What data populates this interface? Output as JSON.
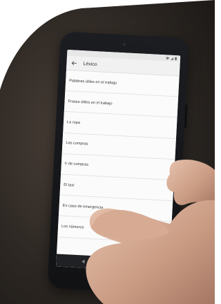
{
  "screen": {
    "title": "Léxico",
    "items": [
      {
        "label": "Palabras útiles en el trabajo"
      },
      {
        "label": "Frases útiles en el trabajo"
      },
      {
        "label": "La ropa"
      },
      {
        "label": "Las compras"
      },
      {
        "label": "Ir de compras"
      },
      {
        "label": "El taxi"
      },
      {
        "label": "En caso de emergencia"
      },
      {
        "label": "Los números"
      }
    ]
  },
  "icons": {
    "back": "arrow-left-icon",
    "status": [
      "wifi-icon",
      "signal-icon",
      "battery-icon"
    ],
    "nav": [
      "nav-back-icon",
      "nav-home-icon",
      "nav-recent-icon"
    ]
  },
  "colors": {
    "screen_bg": "#fafafa",
    "appbar_bg": "#f1f1f1",
    "phone_body": "#16181b",
    "background_dark": "#2b2622",
    "hand_skin": "#d8b09b"
  }
}
